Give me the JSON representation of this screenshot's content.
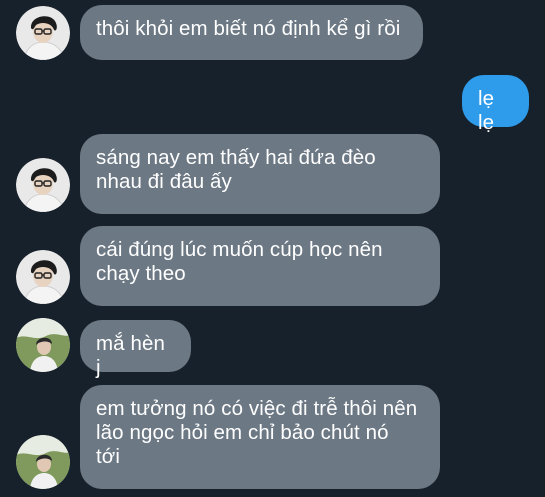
{
  "messages": [
    {
      "id": "m1",
      "direction": "incoming",
      "text": "thôi khỏi em biết nó định kể gì rồi",
      "avatar": "avatar-glasses"
    },
    {
      "id": "m2",
      "direction": "outgoing",
      "text": "lẹ lẹ"
    },
    {
      "id": "m3",
      "direction": "incoming",
      "text": "sáng nay em thấy hai đứa đèo\nnhau đi đâu ấy",
      "avatar": "avatar-glasses"
    },
    {
      "id": "m4",
      "direction": "incoming",
      "text": "cái đúng lúc muốn cúp học nên\nchạy theo",
      "avatar": "avatar-glasses"
    },
    {
      "id": "m5",
      "direction": "incoming",
      "text": "mắ hèn j",
      "avatar": "avatar-outdoor"
    },
    {
      "id": "m6",
      "direction": "incoming",
      "text": "em tưởng nó có việc đi trễ thôi nên\nlão ngọc hỏi em chỉ bảo chút nó\ntới",
      "avatar": "avatar-outdoor"
    }
  ],
  "colors": {
    "background": "#17212b",
    "incoming_bubble": "#6c7884",
    "outgoing_bubble": "#2f9ceb",
    "text": "#ffffff"
  }
}
